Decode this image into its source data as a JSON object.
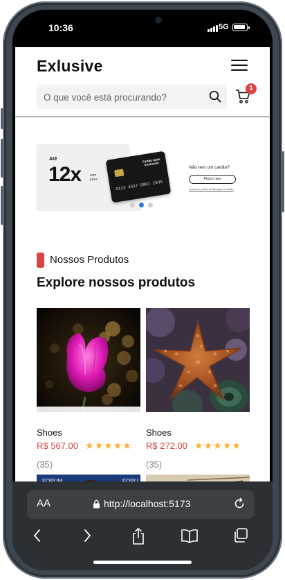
{
  "status_bar": {
    "time": "10:36",
    "network": "5G"
  },
  "header": {
    "logo": "Exlusive",
    "search": {
      "placeholder": "O que você está procurando?",
      "value": ""
    },
    "cart_badge": "1"
  },
  "banner": {
    "prefix": "Até",
    "installments": "12x",
    "suffix": "sem juros",
    "card_name": "Cartão lojas Exclusive",
    "card_number": "0123 4567 8901 2345",
    "no_card_text": "Não tem um cartão?",
    "cta": "Peça o seu",
    "policy_link": "consulte a política de liberação de crédito",
    "slides": 3,
    "active_slide": 2
  },
  "section": {
    "tag": "Nossos Produtos",
    "title": "Explore nossos produtos"
  },
  "products": [
    {
      "name": "Shoes",
      "price": "R$ 567.00",
      "rating": 5,
      "reviews": "(35)",
      "image": "pink-flower-photo"
    },
    {
      "name": "Shoes",
      "price": "R$ 272.00",
      "rating": 5,
      "reviews": "(35)",
      "image": "starfish-photo"
    }
  ],
  "next_row_partial": [
    {
      "image": "forum-banner-photo",
      "visible_text": [
        "FORUM",
        "FORU"
      ]
    },
    {
      "image": "beach-driftwood-photo"
    }
  ],
  "browser": {
    "text_size_label": "AA",
    "url": "http://localhost:5173"
  },
  "colors": {
    "accent": "#db4444",
    "star": "#ffad33",
    "active_dot": "#2a7ae2",
    "browser_chrome": "#2c2f33"
  }
}
